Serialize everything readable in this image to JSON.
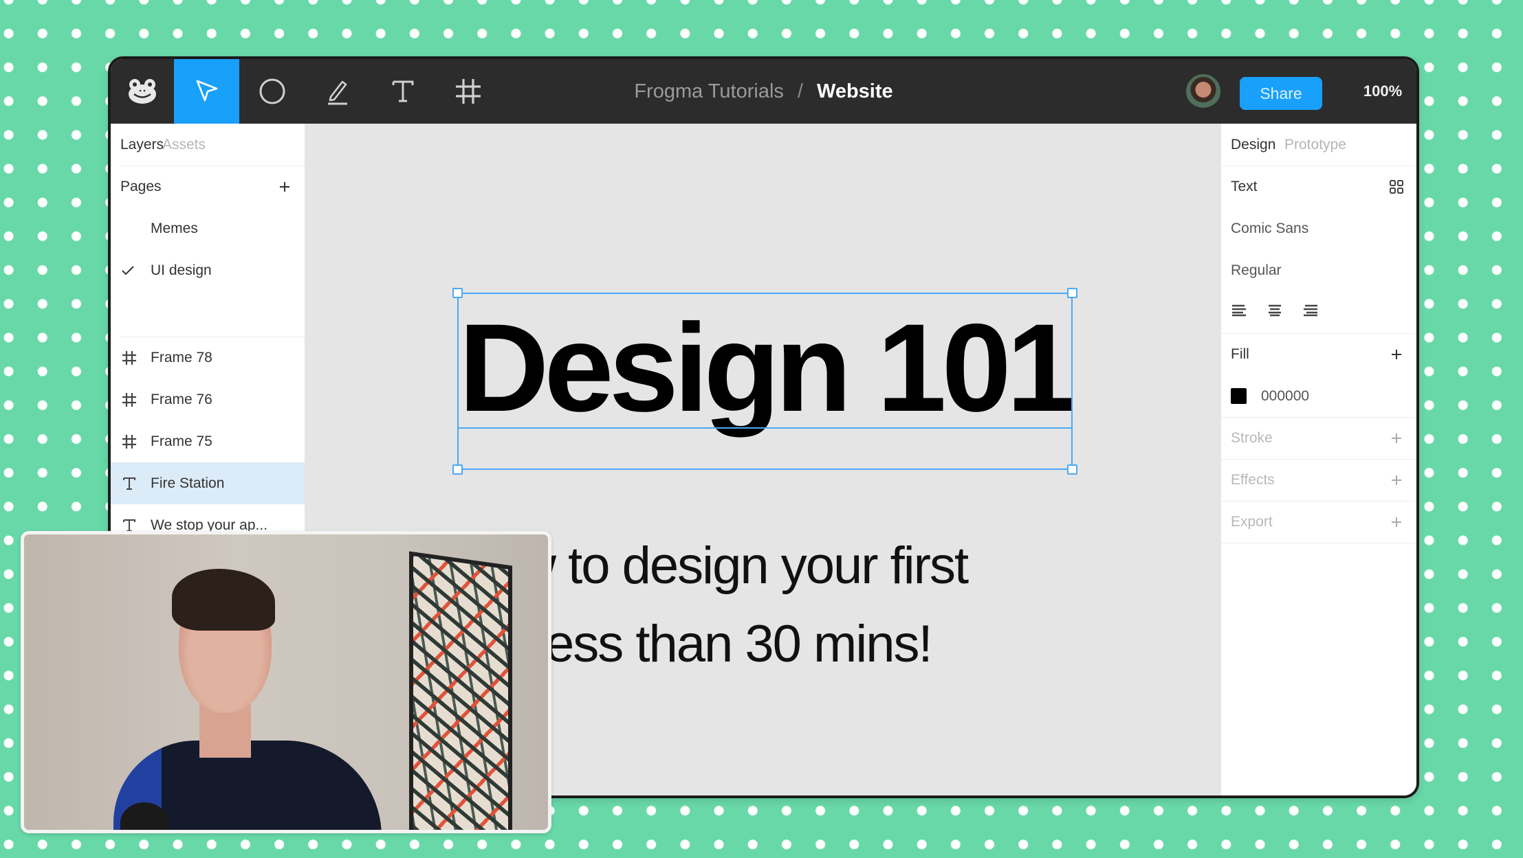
{
  "app": {
    "project": "Frogma Tutorials",
    "separator": "/",
    "file": "Website",
    "share_label": "Share",
    "zoom": "100%",
    "accent_color": "#18a0fb"
  },
  "toolbar": {
    "tools": [
      {
        "name": "frog-logo",
        "icon": "frog-icon"
      },
      {
        "name": "select",
        "icon": "cursor-arrow-icon",
        "active": true
      },
      {
        "name": "ellipse",
        "icon": "circle-icon"
      },
      {
        "name": "pen",
        "icon": "pen-icon"
      },
      {
        "name": "text",
        "icon": "text-t-icon"
      },
      {
        "name": "frame",
        "icon": "frame-hash-icon"
      }
    ]
  },
  "left_panel": {
    "tabs": [
      "Layers",
      "Assets"
    ],
    "active_tab": "Layers",
    "pages_label": "Pages",
    "pages": [
      {
        "name": "Memes",
        "current": false
      },
      {
        "name": "UI design",
        "current": true
      }
    ],
    "layers": [
      {
        "name": "Frame 78",
        "type": "frame",
        "selected": false
      },
      {
        "name": "Frame 76",
        "type": "frame",
        "selected": false
      },
      {
        "name": "Frame 75",
        "type": "frame",
        "selected": false
      },
      {
        "name": "Fire Station",
        "type": "text",
        "selected": true
      },
      {
        "name": "We stop your ap...",
        "type": "text",
        "selected": false
      }
    ]
  },
  "right_panel": {
    "tabs": [
      "Design",
      "Prototype"
    ],
    "active_tab": "Design",
    "section_text": "Text",
    "font_family": "Comic Sans",
    "font_weight": "Regular",
    "align_options": [
      "align-left",
      "align-center",
      "align-right"
    ],
    "fill_label": "Fill",
    "fill_hex": "000000",
    "fill_color": "#000000",
    "stroke_label": "Stroke",
    "effects_label": "Effects",
    "export_label": "Export"
  },
  "canvas": {
    "title": "Design 101",
    "subtitle_line1": "How to design your first",
    "subtitle_line2": "website in less than 30 mins!",
    "subtitle_line2_visible": "in less than 30 mins!"
  },
  "webcam": {
    "description": "presenter webcam overlay"
  }
}
